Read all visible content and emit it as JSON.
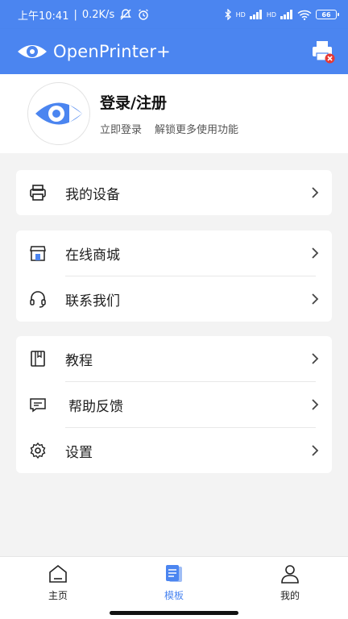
{
  "status_bar": {
    "time": "上午10:41",
    "net_speed": "0.2K/s",
    "battery": "66",
    "signal_1": "HD",
    "signal_2": "HD"
  },
  "app_bar": {
    "title": "OpenPrinter+"
  },
  "profile": {
    "title": "登录/注册",
    "subtitle_1": "立即登录",
    "subtitle_2": "解锁更多使用功能"
  },
  "menu": {
    "my_devices": "我的设备",
    "online_store": "在线商城",
    "contact_us": "联系我们",
    "tutorial": "教程",
    "help_feedback": "帮助反馈",
    "settings": "设置"
  },
  "bottom_nav": {
    "home": "主页",
    "templates": "模板",
    "mine": "我的"
  },
  "colors": {
    "accent": "#4b85f0",
    "error_badge": "#e53935"
  }
}
